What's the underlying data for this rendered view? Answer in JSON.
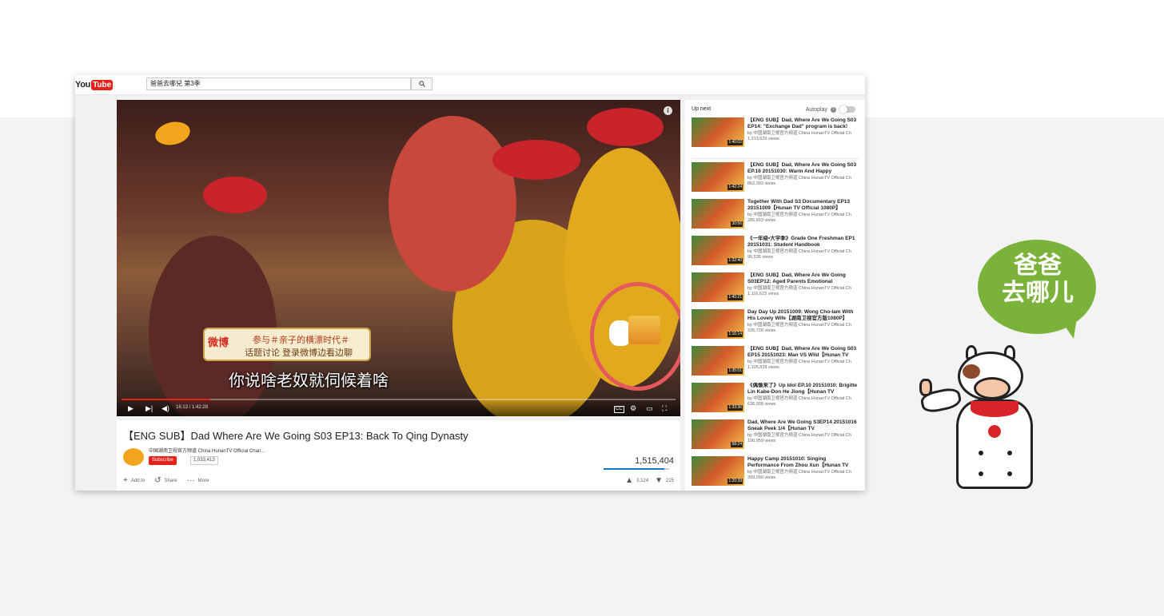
{
  "search": {
    "query": "爸爸去哪兒 第3季"
  },
  "logo": {
    "you": "You",
    "tube": "Tube"
  },
  "player": {
    "weibo_logo": "微博",
    "weibo_line1": "参与＃亲子的横漂时代＃",
    "weibo_line2": "话题讨论 登录微博边看边聊",
    "subtitle": "你说啥老奴就伺候着啥",
    "time": "16:13 / 1:42:28",
    "progress": 0.16,
    "info_label": "i"
  },
  "video": {
    "title": "【ENG SUB】Dad Where Are We Going S03 EP13: Back To Qing Dynasty",
    "channel": "中国湖南卫视官方频道 China HunanTV Official Chan...",
    "subscribe_label": "Subscribe",
    "subscriber_count": "1,033,413",
    "views": "1,515,404",
    "like_ratio": 0.93,
    "actions": {
      "add_to": "Add to",
      "share": "Share",
      "more": "More"
    },
    "likes": "3,124",
    "dislikes": "225"
  },
  "sidebar": {
    "up_next_label": "Up next",
    "autoplay_label": "Autoplay",
    "autoplay_on": false,
    "items": [
      {
        "title": "【ENG SUB】Dad, Where Are We Going S03 EP14: \"Exchange Dad\" program is back!",
        "channel": "by 中国湖南卫视官方频道 China HunanTV Official Ch",
        "views": "1,213,629 views",
        "duration": "1:40:02"
      },
      {
        "title": "【ENG SUB】Dad, Where Are We Going S03 EP.16 20151030: Warm And Happy",
        "channel": "by 中国湖南卫视官方频道 China HunanTV Official Ch",
        "views": "862,303 views",
        "duration": "1:42:24"
      },
      {
        "title": "Together With Dad S3 Documentary EP13 20151009【Hunan TV Official 1080P】",
        "channel": "by 中国湖南卫视官方频道 China HunanTV Official Ch",
        "views": "285,653 views",
        "duration": "30:56"
      },
      {
        "title": "《一年级•大学季》Grade One Freshman EP1 20151031: Student Handbook",
        "channel": "by 中国湖南卫视官方频道 China HunanTV Official Ch",
        "views": "95,535 views",
        "duration": "1:32:40"
      },
      {
        "title": "【ENG SUB】Dad, Where Are We Going S03EP12: Aged Parents Emotional",
        "channel": "by 中国湖南卫视官方频道 China HunanTV Official Ch",
        "views": "1,116,623 views",
        "duration": "1:40:21"
      },
      {
        "title": "Day Day Up 20151009: Wong Cho-lam With His Lovely Wife【湖南卫视官方版1080P】",
        "channel": "by 中国湖南卫视官方频道 China HunanTV Official Ch",
        "views": "335,728 views",
        "duration": "1:16:14"
      },
      {
        "title": "【ENG SUB】Dad, Where Are We Going S03 EP15 20151023: Man VS Wild【Hunan TV",
        "channel": "by 中国湖南卫视官方频道 China HunanTV Official Ch",
        "views": "1,105,828 views",
        "duration": "1:35:51"
      },
      {
        "title": "《偶像来了》Up Idol EP.10 20151010: Brigitte Lin Kabe-Don He Jiong【Hunan TV",
        "channel": "by 中国湖南卫视官方频道 China HunanTV Official Ch",
        "views": "636,308 views",
        "duration": "1:33:36"
      },
      {
        "title": "Dad, Where Are We Going S3EP14 20151016 Sneak Peek 1/4【Hunan TV",
        "channel": "by 中国湖南卫视官方频道 China HunanTV Official Ch",
        "views": "106,959 views",
        "duration": "58:24"
      },
      {
        "title": "Happy Camp 20151010: Singing Performance From Zhou Xun【Hunan TV",
        "channel": "by 中国湖南卫视官方频道 China HunanTV Official Ch",
        "views": "399,090 views",
        "duration": "1:20:39"
      }
    ]
  },
  "brand": {
    "line1": "爸爸",
    "line2": "去哪儿",
    "green": "#7ab23a"
  },
  "colors": {
    "accent_red": "#e62117",
    "ring": "#e5585c",
    "link_blue": "#167ac6"
  },
  "icons": [
    "search-icon",
    "play-icon",
    "next-icon",
    "volume-icon",
    "cc-icon",
    "settings-icon",
    "theater-icon",
    "fullscreen-icon",
    "plus-icon",
    "share-icon",
    "more-icon",
    "thumbs-up-icon",
    "thumbs-down-icon",
    "info-icon"
  ]
}
